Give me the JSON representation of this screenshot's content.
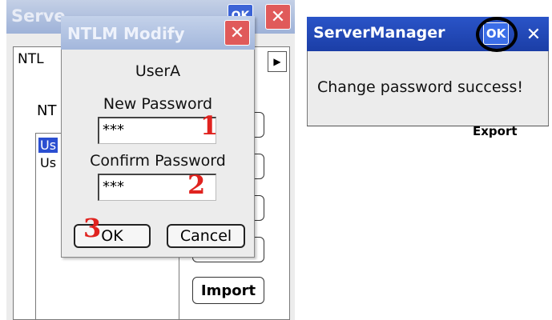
{
  "bg_window": {
    "title": "Serve",
    "ok_label": "OK",
    "close_glyph": "✕",
    "tab_label": "NTL",
    "tab_arrow": "▶",
    "ntlm_label": "NT",
    "list_items": [
      "Us",
      "Us"
    ],
    "import_label": "Import"
  },
  "dialog": {
    "title": "NTLM Modify",
    "close_glyph": "✕",
    "user": "UserA",
    "new_password_label": "New Password",
    "new_password_value": "***",
    "confirm_password_label": "Confirm Password",
    "confirm_password_value": "***",
    "ok_label": "OK",
    "cancel_label": "Cancel",
    "step_markers": [
      "1",
      "2",
      "3"
    ]
  },
  "popup": {
    "title": "ServerManager",
    "ok_label": "OK",
    "close_glyph": "✕",
    "message": "Change password success!",
    "partial_text": "Export"
  },
  "colors": {
    "marker_red": "#e0231f",
    "selection_blue": "#2b4fd1",
    "popup_title_blue": "#1b3ea6"
  }
}
